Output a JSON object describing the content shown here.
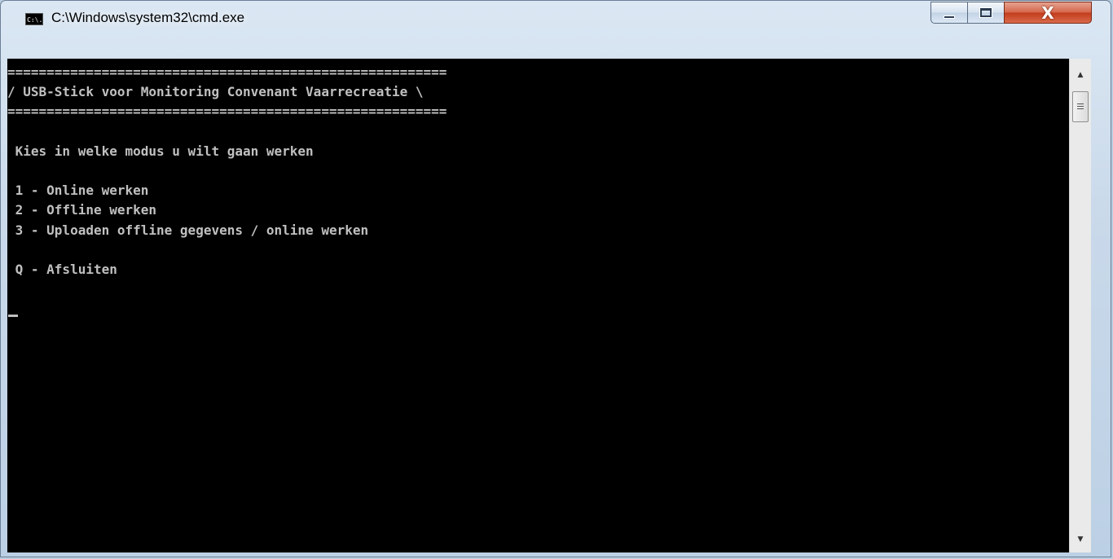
{
  "window": {
    "title": "C:\\Windows\\system32\\cmd.exe",
    "icon_label": "C:\\."
  },
  "controls": {
    "minimize": "minimize-icon",
    "maximize": "maximize-icon",
    "close": "X"
  },
  "console": {
    "lines": [
      "========================================================",
      "/ USB-Stick voor Monitoring Convenant Vaarrecreatie \\",
      "========================================================",
      "",
      " Kies in welke modus u wilt gaan werken",
      "",
      " 1 - Online werken",
      " 2 - Offline werken",
      " 3 - Uploaden offline gegevens / online werken",
      "",
      " Q - Afsluiten"
    ]
  },
  "colors": {
    "console_bg": "#000000",
    "console_fg": "#c0c0c0",
    "close_button": "#c7422a"
  }
}
